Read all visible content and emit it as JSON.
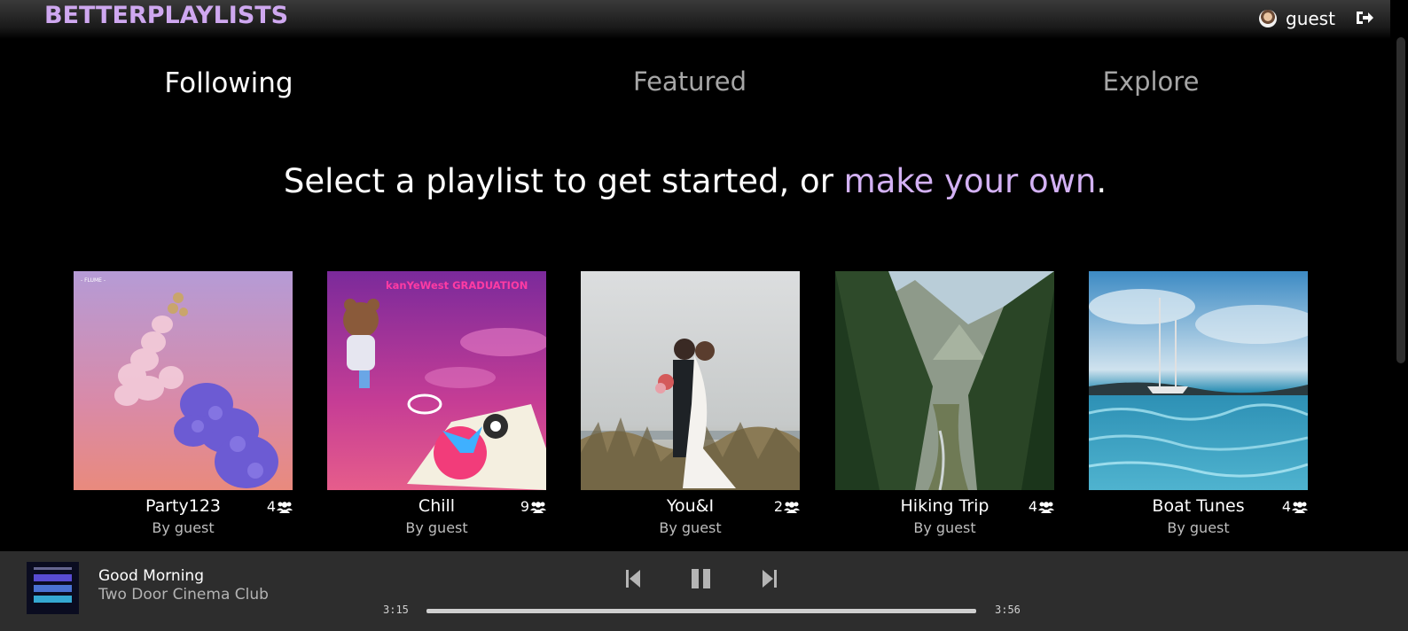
{
  "app": {
    "logo": "BETTERPLAYLISTS",
    "accent": "#cfa8f0"
  },
  "user": {
    "name": "guest"
  },
  "tabs": [
    {
      "label": "Following",
      "active": true
    },
    {
      "label": "Featured",
      "active": false
    },
    {
      "label": "Explore",
      "active": false
    }
  ],
  "headline": {
    "prefix": "Select a playlist to get started, or ",
    "link": "make your own",
    "suffix": "."
  },
  "playlists": [
    {
      "title": "Party123",
      "author": "By guest",
      "followers": "4"
    },
    {
      "title": "Chill",
      "author": "By guest",
      "followers": "9"
    },
    {
      "title": "You&I",
      "author": "By guest",
      "followers": "2"
    },
    {
      "title": "Hiking Trip",
      "author": "By guest",
      "followers": "4"
    },
    {
      "title": "Boat Tunes",
      "author": "By guest",
      "followers": "4"
    }
  ],
  "cover_text": {
    "party": {
      "label": "- FLUME -"
    },
    "chill": {
      "label": "kanYeWest GRADUATION"
    }
  },
  "player": {
    "track_title": "Good Morning",
    "track_artist": "Two Door Cinema Club",
    "elapsed": "3:15",
    "duration": "3:56",
    "state": "playing"
  },
  "icons": {
    "followers": "users-icon",
    "logout": "sign-out-icon",
    "prev": "skip-previous-icon",
    "pause": "pause-icon",
    "next": "skip-next-icon"
  }
}
